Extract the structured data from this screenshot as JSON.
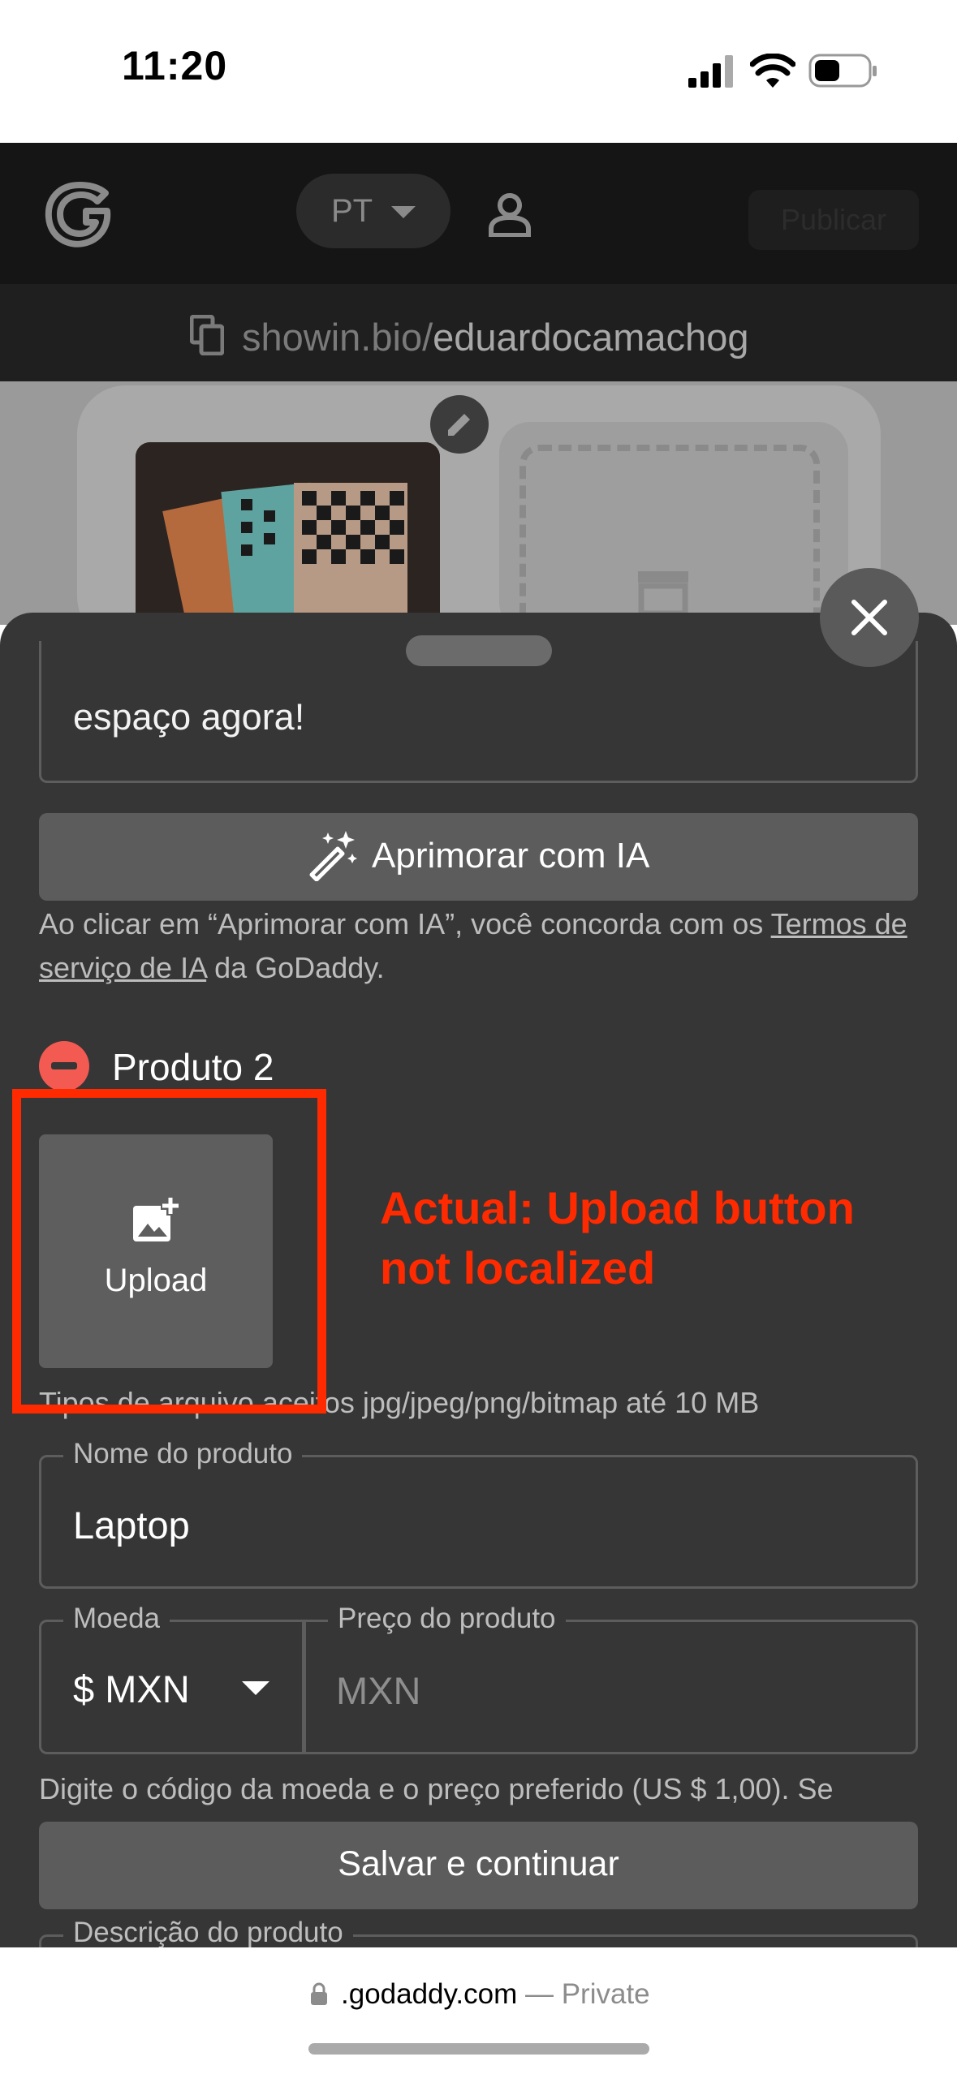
{
  "status_bar": {
    "time": "11:20"
  },
  "header": {
    "language": "PT",
    "publish_label": "Publicar",
    "url_domain": "showin.bio/",
    "url_path": "eduardocamachog"
  },
  "sheet": {
    "description_tail": "espaço agora!",
    "ai_button_label": "Aprimorar com IA",
    "ai_disclaimer_prefix": "Ao clicar em “Aprimorar com IA”, você concorda com os ",
    "ai_disclaimer_link": "Termos de serviço de IA",
    "ai_disclaimer_suffix": " da GoDaddy.",
    "product_heading": "Produto 2",
    "upload_label": "Upload",
    "file_hint": "Tipos de arquivo aceitos jpg/jpeg/png/bitmap até 10 MB",
    "name_label": "Nome do produto",
    "name_value": "Laptop",
    "currency_label": "Moeda",
    "currency_value": "$ MXN",
    "price_label": "Preço do produto",
    "price_placeholder": "MXN",
    "price_hint": "Digite o código da moeda e o preço preferido (US $ 1,00). Se",
    "save_label": "Salvar e continuar",
    "product_description_label": "Descrição do produto"
  },
  "annotation": {
    "text": "Actual: Upload button not localized",
    "color": "#ff2a00"
  },
  "browser": {
    "domain": ".godaddy.com",
    "mode": " — Private"
  },
  "colors": {
    "sheet_bg": "#363636",
    "button_bg": "#5c5c5c",
    "remove_red": "#f25a52"
  }
}
